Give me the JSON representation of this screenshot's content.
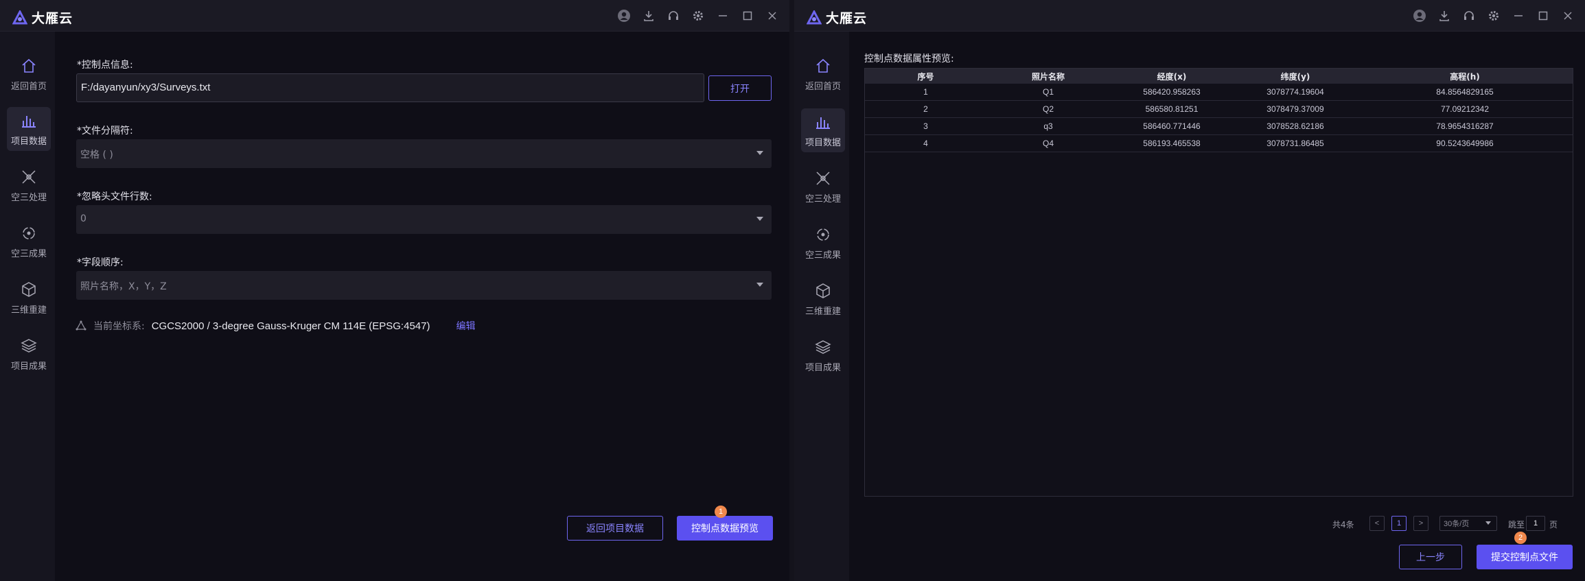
{
  "app": {
    "name": "大雁云"
  },
  "colors": {
    "accent": "#5b50f0",
    "badge": "#f0884c",
    "bg": "#0f0e17"
  },
  "window_controls": [
    "user-icon",
    "download-icon",
    "headset-icon",
    "gear-icon",
    "minimize-icon",
    "maximize-icon",
    "close-icon"
  ],
  "sidebar": {
    "items": [
      {
        "label": "返回首页",
        "icon": "home-icon"
      },
      {
        "label": "项目数据",
        "icon": "bar-chart-icon"
      },
      {
        "label": "空三处理",
        "icon": "aerial-process-icon"
      },
      {
        "label": "空三成果",
        "icon": "aerial-result-icon"
      },
      {
        "label": "三维重建",
        "icon": "cube-icon"
      },
      {
        "label": "项目成果",
        "icon": "layers-icon"
      }
    ],
    "active_index": 1
  },
  "left": {
    "control_info_label": "*控制点信息:",
    "file_path": "F:/dayanyun/xy3/Surveys.txt",
    "open_button": "打开",
    "separator_label": "*文件分隔符:",
    "separator_value": "空格 ( )",
    "skip_label": "*忽略头文件行数:",
    "skip_value": "0",
    "order_label": "*字段顺序:",
    "order_placeholder": "照片名称，X，Y，Z",
    "coord_key": "当前坐标系:",
    "coord_value": "CGCS2000 / 3-degree Gauss-Kruger CM 114E (EPSG:4547)",
    "edit_link": "编辑",
    "back_button": "返回项目数据",
    "preview_button": "控制点数据预览",
    "preview_badge": "1"
  },
  "right": {
    "table_title": "控制点数据属性预览:",
    "columns": [
      "序号",
      "照片名称",
      "经度(x)",
      "纬度(y)",
      "高程(h)"
    ],
    "rows": [
      [
        "1",
        "Q1",
        "586420.958263",
        "3078774.19604",
        "84.8564829165"
      ],
      [
        "2",
        "Q2",
        "586580.81251",
        "3078479.37009",
        "77.09212342"
      ],
      [
        "3",
        "q3",
        "586460.771446",
        "3078528.62186",
        "78.9654316287"
      ],
      [
        "4",
        "Q4",
        "586193.465538",
        "3078731.86485",
        "90.5243649986"
      ]
    ],
    "pagination": {
      "total": "共4条",
      "prev": "<",
      "current_page": "1",
      "next": ">",
      "page_size": "30条/页",
      "jump_label": "跳至",
      "jump_value": "1",
      "page_unit": "页"
    },
    "prev_step_button": "上一步",
    "submit_button": "提交控制点文件",
    "submit_badge": "2"
  }
}
